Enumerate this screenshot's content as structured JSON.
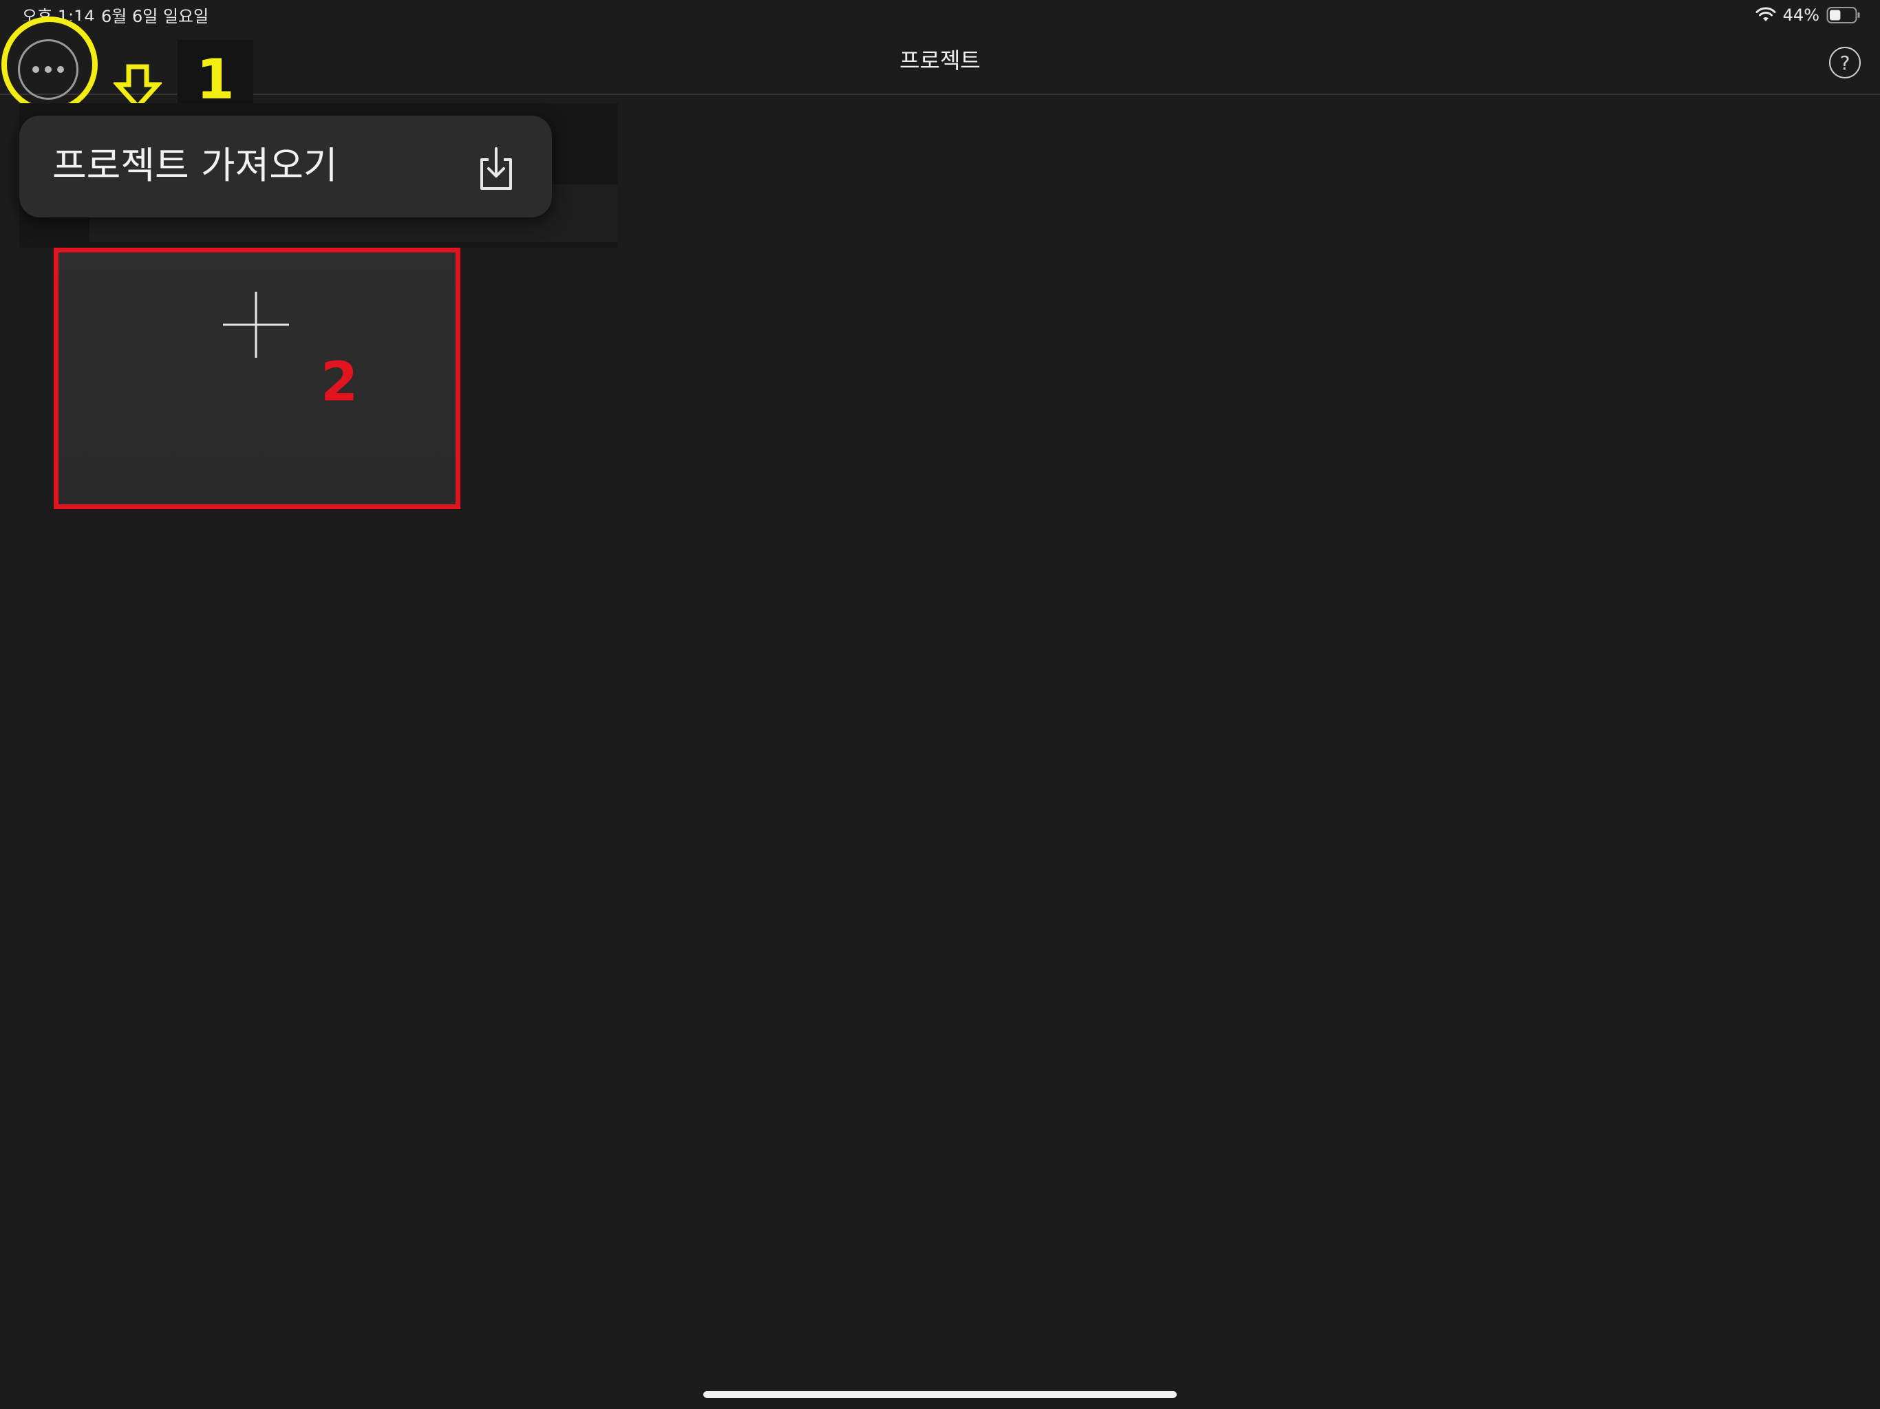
{
  "status_bar": {
    "time": "오후 1:14",
    "date": "6월 6일 일요일",
    "battery_percent": "44%",
    "battery_level": 0.44,
    "wifi_icon": "wifi-icon",
    "battery_icon": "battery-icon"
  },
  "nav": {
    "title": "프로젝트",
    "more_icon": "ellipsis-circle-icon",
    "help_label": "?",
    "help_icon": "question-circle-icon"
  },
  "popup_menu": {
    "items": [
      {
        "label": "프로젝트 가져오기",
        "icon": "import-icon"
      }
    ]
  },
  "projects": {
    "new_project_icon": "plus-icon"
  },
  "annotations": {
    "step1_label": "1",
    "step2_label": "2",
    "highlight_color": "#f5ee13",
    "outline_color": "#e0151f"
  },
  "colors": {
    "background": "#1c1c1c",
    "menu_background": "#2c2c2c",
    "tile_background": "#2d2d2d"
  }
}
